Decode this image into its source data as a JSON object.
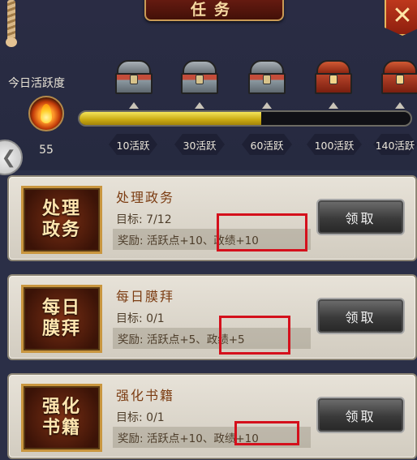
{
  "window": {
    "title": "任务",
    "close_icon": "x-icon"
  },
  "activity": {
    "label": "今日活跃度",
    "value": "55",
    "progress_percent": 55,
    "milestones": [
      {
        "label": "10活跃",
        "chest": "grey-chest"
      },
      {
        "label": "30活跃",
        "chest": "grey-chest"
      },
      {
        "label": "60活跃",
        "chest": "grey-chest"
      },
      {
        "label": "100活跃",
        "chest": "red-chest"
      },
      {
        "label": "140活跃",
        "chest": "red-chest"
      }
    ]
  },
  "tasks": [
    {
      "icon_text": "处理政务",
      "name": "处理政务",
      "goal": "目标: 7/12",
      "reward": "奖励: 活跃点+10、政绩+10",
      "button": "领取"
    },
    {
      "icon_text": "每日膜拜",
      "name": "每日膜拜",
      "goal": "目标: 0/1",
      "reward": "奖励: 活跃点+5、政绩+5",
      "button": "领取"
    },
    {
      "icon_text": "强化书籍",
      "name": "强化书籍",
      "goal": "目标: 0/1",
      "reward": "奖励: 活跃点+10、政绩+10",
      "button": "领取"
    }
  ],
  "colors": {
    "highlight": "#d4101c",
    "progress": "#c9a912",
    "task_name": "#7c3d13"
  }
}
